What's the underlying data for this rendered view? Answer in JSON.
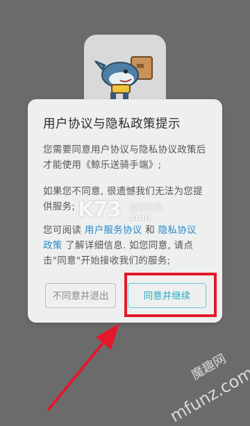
{
  "dialog": {
    "title": "用户协议与隐私政策提示",
    "para1": "您需要同意用户协议与隐私协议政策后才能使用《鲸乐送骑手端》;",
    "para2": "如果您不同意, 很遗憾我们无法为您提供服务;",
    "para3_prefix": "您可阅读 ",
    "link_user_agreement": "用户服务协议",
    "para3_and": " 和 ",
    "link_privacy_1": "隐私协议",
    "link_privacy_2": "政策",
    "para3_suffix": " 了解详细信息. 如您同意, 请点击\"同意\"开始接收我们的服务;",
    "decline_label": "不同意并退出",
    "accept_label": "同意并继续"
  },
  "watermarks": {
    "k73_main": "K73",
    "k73_cn": "游戏之家",
    "k73_com": ".com",
    "mfunz_cn": "魔趣网",
    "mfunz_en": "mfunz.com"
  },
  "colors": {
    "overlay": "#6b6b6b",
    "link": "#2a88c8",
    "accept_border": "#66c8d8",
    "highlight": "#e4182a"
  }
}
